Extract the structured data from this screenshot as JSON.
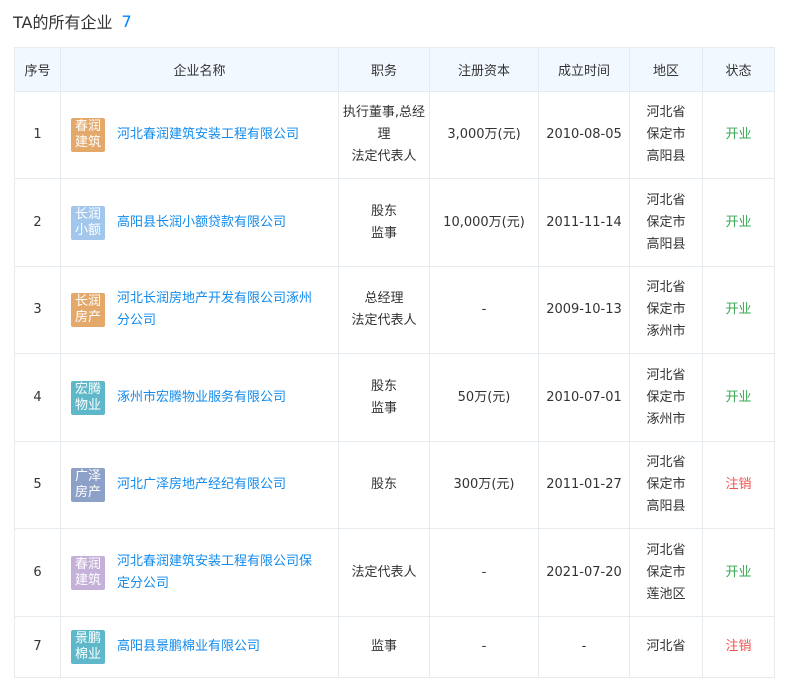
{
  "header": {
    "title": "TA的所有企业",
    "count": "7"
  },
  "columns": [
    "序号",
    "企业名称",
    "职务",
    "注册资本",
    "成立时间",
    "地区",
    "状态"
  ],
  "colors": {
    "link": "#128bed",
    "open": "#3aa853",
    "closed": "#ef5350",
    "header_bg": "#f2f8ff",
    "border": "#e6ebf0"
  },
  "rows": [
    {
      "index": "1",
      "logo_text": "春润建筑",
      "logo_color": "#e3a86a",
      "name": "河北春润建筑安装工程有限公司",
      "roles": [
        "执行董事,总经理",
        "法定代表人"
      ],
      "capital": "3,000万(元)",
      "founded": "2010-08-05",
      "region": [
        "河北省",
        "保定市",
        "高阳县"
      ],
      "status": "开业",
      "status_type": "open"
    },
    {
      "index": "2",
      "logo_text": "长润小额",
      "logo_color": "#a3c7ec",
      "name": "高阳县长润小额贷款有限公司",
      "roles": [
        "股东",
        "监事"
      ],
      "capital": "10,000万(元)",
      "founded": "2011-11-14",
      "region": [
        "河北省",
        "保定市",
        "高阳县"
      ],
      "status": "开业",
      "status_type": "open"
    },
    {
      "index": "3",
      "logo_text": "长润房产",
      "logo_color": "#e3a86a",
      "name": "河北长润房地产开发有限公司涿州分公司",
      "roles": [
        "总经理",
        "法定代表人"
      ],
      "capital": "-",
      "founded": "2009-10-13",
      "region": [
        "河北省",
        "保定市",
        "涿州市"
      ],
      "status": "开业",
      "status_type": "open"
    },
    {
      "index": "4",
      "logo_text": "宏腾物业",
      "logo_color": "#5fb8c9",
      "name": "涿州市宏腾物业服务有限公司",
      "roles": [
        "股东",
        "监事"
      ],
      "capital": "50万(元)",
      "founded": "2010-07-01",
      "region": [
        "河北省",
        "保定市",
        "涿州市"
      ],
      "status": "开业",
      "status_type": "open"
    },
    {
      "index": "5",
      "logo_text": "广泽房产",
      "logo_color": "#8da0c7",
      "name": "河北广泽房地产经纪有限公司",
      "roles": [
        "股东"
      ],
      "capital": "300万(元)",
      "founded": "2011-01-27",
      "region": [
        "河北省",
        "保定市",
        "高阳县"
      ],
      "status": "注销",
      "status_type": "closed"
    },
    {
      "index": "6",
      "logo_text": "春润建筑",
      "logo_color": "#c4b0d8",
      "name": "河北春润建筑安装工程有限公司保定分公司",
      "roles": [
        "法定代表人"
      ],
      "capital": "-",
      "founded": "2021-07-20",
      "region": [
        "河北省",
        "保定市",
        "莲池区"
      ],
      "status": "开业",
      "status_type": "open"
    },
    {
      "index": "7",
      "logo_text": "景鹏棉业",
      "logo_color": "#5fb8c9",
      "name": "高阳县景鹏棉业有限公司",
      "roles": [
        "监事"
      ],
      "capital": "-",
      "founded": "-",
      "region": [
        "河北省"
      ],
      "status": "注销",
      "status_type": "closed"
    }
  ]
}
